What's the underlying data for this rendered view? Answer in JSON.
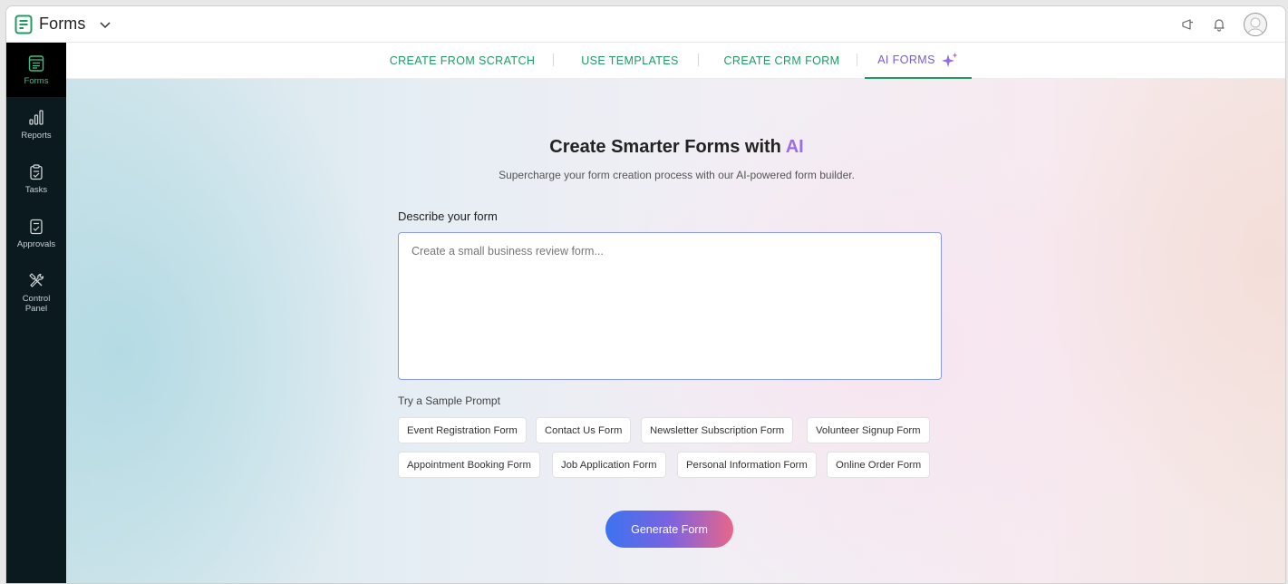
{
  "app": {
    "title": "Forms"
  },
  "sidebar": {
    "items": [
      {
        "label": "Forms",
        "icon": "forms-icon",
        "active": true
      },
      {
        "label": "Reports",
        "icon": "bar-chart-icon"
      },
      {
        "label": "Tasks",
        "icon": "clipboard-check-icon"
      },
      {
        "label": "Approvals",
        "icon": "approval-doc-icon"
      },
      {
        "label": "Control Panel",
        "icon": "tools-icon"
      }
    ]
  },
  "tabs": [
    {
      "label": "CREATE FROM SCRATCH"
    },
    {
      "label": "USE TEMPLATES"
    },
    {
      "label": "CREATE CRM FORM"
    },
    {
      "label": "AI FORMS",
      "active": true,
      "icon": "sparkle-icon"
    }
  ],
  "main": {
    "headline_prefix": "Create Smarter Forms with ",
    "headline_accent": "AI",
    "subline": "Supercharge your form creation process with our AI-powered form builder.",
    "describe_label": "Describe your form",
    "prompt_placeholder": "Create a small business review form...",
    "prompt_value": "",
    "sample_label": "Try a Sample Prompt",
    "sample_prompts": [
      "Event Registration Form",
      "Contact Us Form",
      "Newsletter Subscription Form",
      "Volunteer Signup Form",
      "Appointment Booking Form",
      "Job Application Form",
      "Personal Information Form",
      "Online Order Form"
    ],
    "generate_label": "Generate Form"
  },
  "colors": {
    "brand_green": "#1f9a63",
    "ai_purple": "#9a6fe0",
    "sidebar_bg": "#0b1a1f"
  }
}
